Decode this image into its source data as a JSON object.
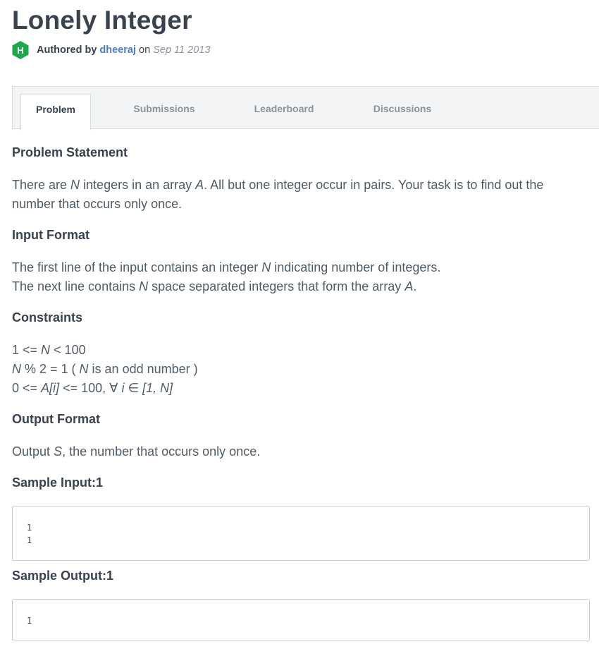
{
  "page": {
    "title": "Lonely Integer",
    "author": {
      "logo_letter": "H",
      "prefix": "Authored by",
      "name": "dheeraj",
      "on": "on",
      "date": "Sep 11 2013",
      "logo_color": "#1ba94c"
    }
  },
  "tabs": [
    {
      "label": "Problem",
      "active": true
    },
    {
      "label": "Submissions",
      "active": false
    },
    {
      "label": "Leaderboard",
      "active": false
    },
    {
      "label": "Discussions",
      "active": false
    }
  ],
  "problem": {
    "statement_heading": "Problem Statement",
    "statement": {
      "t1": "There are ",
      "v1": "N",
      "t2": " integers in an array ",
      "v2": "A",
      "t3": ". All but one integer occur in pairs. Your task is to find out the number that occurs only once."
    },
    "input_heading": "Input Format",
    "input": {
      "l1_t1": "The first line of the input contains an integer ",
      "l1_v1": "N",
      "l1_t2": " indicating number of integers.",
      "l2_t1": "The next line contains ",
      "l2_v1": "N",
      "l2_t2": " space separated integers that form the array ",
      "l2_v2": "A",
      "l2_t3": "."
    },
    "constraints_heading": "Constraints",
    "constraints": {
      "c1_t1": "1 <= ",
      "c1_v1": "N",
      "c1_t2": " < 100",
      "c2_v1": "N",
      "c2_t1": " % 2 = 1 ( ",
      "c2_v2": "N",
      "c2_t2": " is an odd number )",
      "c3_t1": "0 <= ",
      "c3_v1": "A[i]",
      "c3_t2": " <= 100, ∀ ",
      "c3_v2": "i",
      "c3_t3": " ∈ ",
      "c3_v3": "[1, N]"
    },
    "output_heading": "Output Format",
    "output": {
      "t1": "Output ",
      "v1": "S",
      "t2": ", the number that occurs only once."
    },
    "sample_input_heading": "Sample Input:1",
    "sample_input": "1\n1",
    "sample_output_heading": "Sample Output:1",
    "sample_output": "1"
  }
}
